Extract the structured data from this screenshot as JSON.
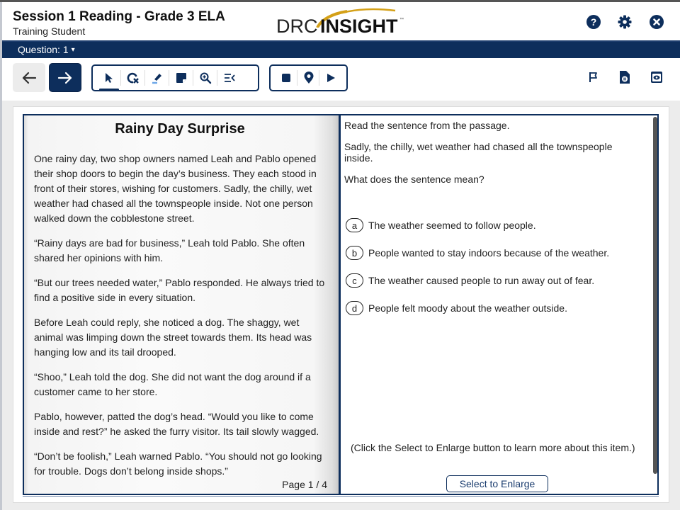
{
  "header": {
    "title": "Session 1 Reading - Grade 3 ELA",
    "subtitle": "Training Student",
    "logo": {
      "part1": "DRC",
      "part2": "INSIGHT",
      "tm": "™"
    },
    "icons": [
      "help-icon",
      "settings-gear-icon",
      "close-icon"
    ]
  },
  "question_bar": {
    "label": "Question: 1",
    "caret": "▾"
  },
  "toolbar": {
    "nav": [
      "back-arrow-icon",
      "next-arrow-icon"
    ],
    "tools": [
      "pointer-icon",
      "option-eliminator-icon",
      "highlighter-icon",
      "sticky-note-icon",
      "magnifier-icon",
      "line-reader-icon"
    ],
    "audio": [
      "stop-icon",
      "location-pin-icon",
      "play-icon"
    ],
    "right_tools": [
      "flag-icon",
      "pause-test-icon",
      "review-icon"
    ]
  },
  "passage": {
    "title": "Rainy Day Surprise",
    "paragraphs": [
      "One rainy day, two shop owners named Leah and Pablo opened their shop doors to begin the day’s business. They each stood in front of their stores, wishing for customers. Sadly, the chilly, wet weather had chased all the townspeople inside. Not one person walked down the cobblestone street.",
      "“Rainy days are bad for business,” Leah told Pablo. She often shared her opinions with him.",
      "“But our trees needed water,” Pablo responded. He always tried to find a positive side in every situation.",
      "Before Leah could reply, she noticed a dog. The shaggy, wet animal was limping down the street towards them. Its head was hanging low and its tail drooped.",
      "“Shoo,” Leah told the dog. She did not want the dog around if a customer came to her store.",
      "Pablo, however, patted the dog’s head. “Would you like to come inside and rest?” he asked the furry visitor. Its tail slowly wagged.",
      "“Don’t be foolish,” Leah warned Pablo. “You should not go looking for trouble. Dogs don’t belong inside shops.”"
    ],
    "page_indicator": "Page 1 / 4"
  },
  "item": {
    "stem": [
      "Read the sentence from the passage.",
      "Sadly, the chilly, wet weather had chased all the townspeople inside.",
      "What does the sentence mean?"
    ],
    "options": [
      {
        "letter": "a",
        "text": "The weather seemed to follow people."
      },
      {
        "letter": "b",
        "text": "People wanted to stay indoors because of the weather."
      },
      {
        "letter": "c",
        "text": "The weather caused people to run away out of fear."
      },
      {
        "letter": "d",
        "text": "People felt moody about the weather outside."
      }
    ],
    "hint": "(Click the Select to Enlarge button to learn more about this item.)",
    "enlarge_button": "Select to Enlarge"
  },
  "colors": {
    "brand_navy": "#0d2e5c",
    "logo_gold": "#d4a017"
  }
}
